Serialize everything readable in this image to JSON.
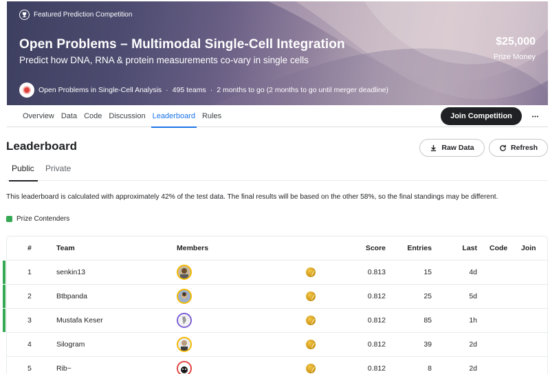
{
  "hero": {
    "badge": "Featured Prediction Competition",
    "title": "Open Problems – Multimodal Single-Cell Integration",
    "subtitle": "Predict how DNA, RNA & protein measurements co-vary in single cells",
    "prize_amount": "$25,000",
    "prize_label": "Prize Money",
    "host": "Open Problems in Single-Cell Analysis",
    "teams": "495 teams",
    "deadline": "2 months to go (2 months to go until merger deadline)",
    "separator": "·"
  },
  "nav": {
    "tabs": [
      "Overview",
      "Data",
      "Code",
      "Discussion",
      "Leaderboard",
      "Rules"
    ],
    "active_tab": "Leaderboard",
    "join_label": "Join Competition",
    "more_label": "•••"
  },
  "leaderboard": {
    "title": "Leaderboard",
    "raw_data_label": "Raw Data",
    "refresh_label": "Refresh",
    "tabs": [
      "Public",
      "Private"
    ],
    "active_tab": "Public",
    "note": "This leaderboard is calculated with approximately 42% of the test data. The final results will be based on the other 58%, so the final standings may be different.",
    "legend_label": "Prize Contenders",
    "legend_color": "#34a853",
    "columns": {
      "rank": "#",
      "team": "Team",
      "members": "Members",
      "score": "Score",
      "entries": "Entries",
      "last": "Last",
      "code": "Code",
      "join": "Join"
    },
    "rows": [
      {
        "rank": "1",
        "team": "senkin13",
        "score": "0.813",
        "entries": "15",
        "last": "4d",
        "prize_contender": true,
        "medal": "gold"
      },
      {
        "rank": "2",
        "team": "Btbpanda",
        "score": "0.812",
        "entries": "25",
        "last": "5d",
        "prize_contender": true,
        "medal": "gold"
      },
      {
        "rank": "3",
        "team": "Mustafa Keser",
        "score": "0.812",
        "entries": "85",
        "last": "1h",
        "prize_contender": true,
        "medal": "gold"
      },
      {
        "rank": "4",
        "team": "Silogram",
        "score": "0.812",
        "entries": "39",
        "last": "2d",
        "prize_contender": false,
        "medal": "gold"
      },
      {
        "rank": "5",
        "team": "Rib~",
        "score": "0.812",
        "entries": "8",
        "last": "2d",
        "prize_contender": false,
        "medal": "gold"
      }
    ]
  },
  "colors": {
    "accent": "#1a73e8",
    "dark_button": "#202124",
    "prize_green": "#34a853",
    "gold": "#d19a17"
  }
}
